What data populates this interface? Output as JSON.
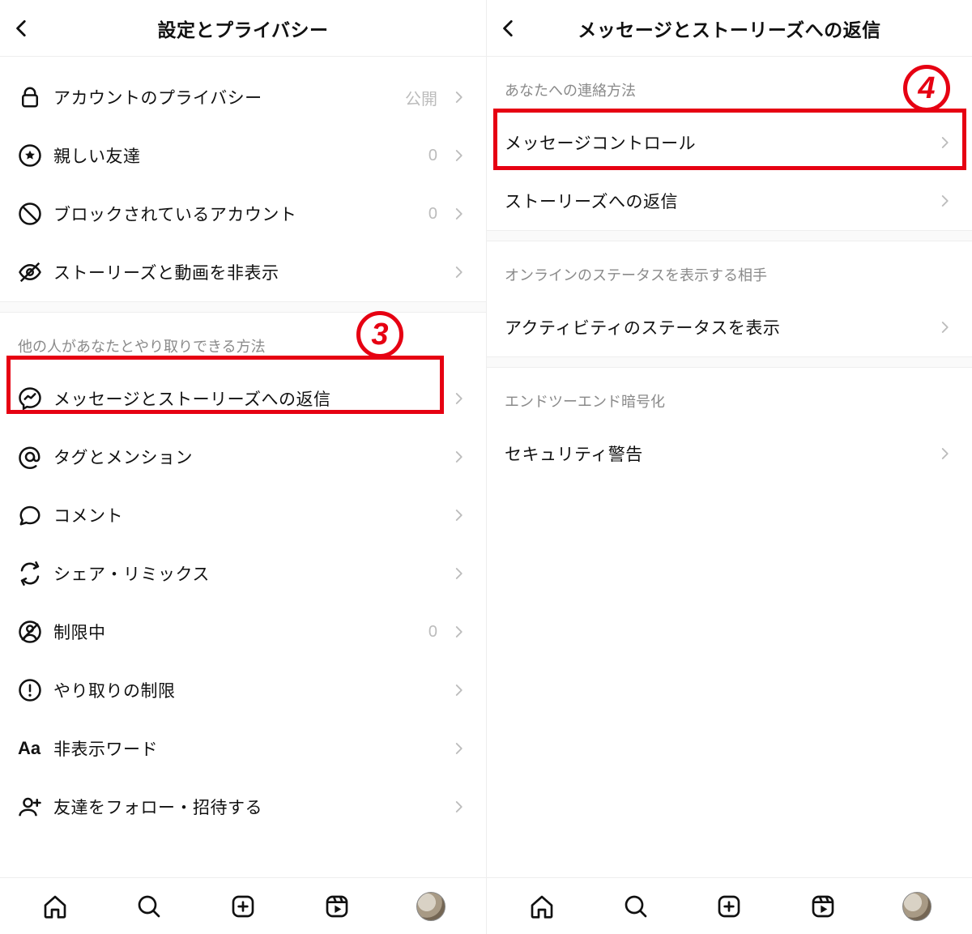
{
  "left": {
    "title": "設定とプライバシー",
    "section1": [
      {
        "icon": "lock",
        "label": "アカウントのプライバシー",
        "value": "公開"
      },
      {
        "icon": "star-circle",
        "label": "親しい友達",
        "value": "0"
      },
      {
        "icon": "ban",
        "label": "ブロックされているアカウント",
        "value": "0"
      },
      {
        "icon": "eye-off",
        "label": "ストーリーズと動画を非表示",
        "value": ""
      }
    ],
    "section2_header": "他の人があなたとやり取りできる方法",
    "section2": [
      {
        "icon": "messenger",
        "label": "メッセージとストーリーズへの返信",
        "value": ""
      },
      {
        "icon": "at",
        "label": "タグとメンション",
        "value": ""
      },
      {
        "icon": "comment",
        "label": "コメント",
        "value": ""
      },
      {
        "icon": "remix",
        "label": "シェア・リミックス",
        "value": ""
      },
      {
        "icon": "restricted",
        "label": "制限中",
        "value": "0"
      },
      {
        "icon": "alert-circle",
        "label": "やり取りの制限",
        "value": ""
      },
      {
        "icon": "aa",
        "label": "非表示ワード",
        "value": ""
      },
      {
        "icon": "person-add",
        "label": "友達をフォロー・招待する",
        "value": ""
      }
    ],
    "callout": "3"
  },
  "right": {
    "title": "メッセージとストーリーズへの返信",
    "sectionA_header": "あなたへの連絡方法",
    "sectionA": [
      {
        "label": "メッセージコントロール"
      },
      {
        "label": "ストーリーズへの返信"
      }
    ],
    "sectionB_header": "オンラインのステータスを表示する相手",
    "sectionB": [
      {
        "label": "アクティビティのステータスを表示"
      }
    ],
    "sectionC_header": "エンドツーエンド暗号化",
    "sectionC": [
      {
        "label": "セキュリティ警告"
      }
    ],
    "callout": "4"
  }
}
